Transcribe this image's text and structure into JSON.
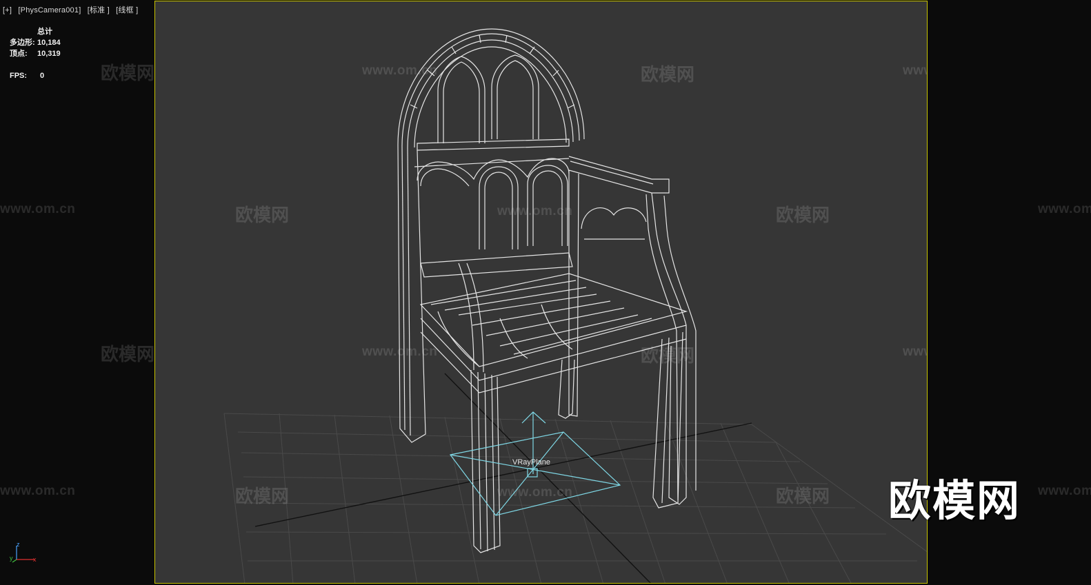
{
  "viewport": {
    "labels": [
      "[+]",
      "[PhysCamera001]",
      "[标准 ]",
      "[线框 ]"
    ]
  },
  "stats": {
    "header": "总计",
    "polys_label": "多边形:",
    "polys_value": "10,184",
    "verts_label": "顶点:",
    "verts_value": "10,319",
    "fps_label": "FPS:",
    "fps_value": "0"
  },
  "scene": {
    "object_label": "VRayPlane",
    "axis": {
      "x": "x",
      "y": "y",
      "z": "z"
    }
  },
  "watermarks": {
    "brand": "欧模网",
    "url": "www.om.cn"
  },
  "logo": "欧模网",
  "colors": {
    "frame_border": "#c9c400",
    "viewport_bg": "#363636",
    "wire": "#e8e8e8",
    "gizmo": "#7fd8e6"
  }
}
